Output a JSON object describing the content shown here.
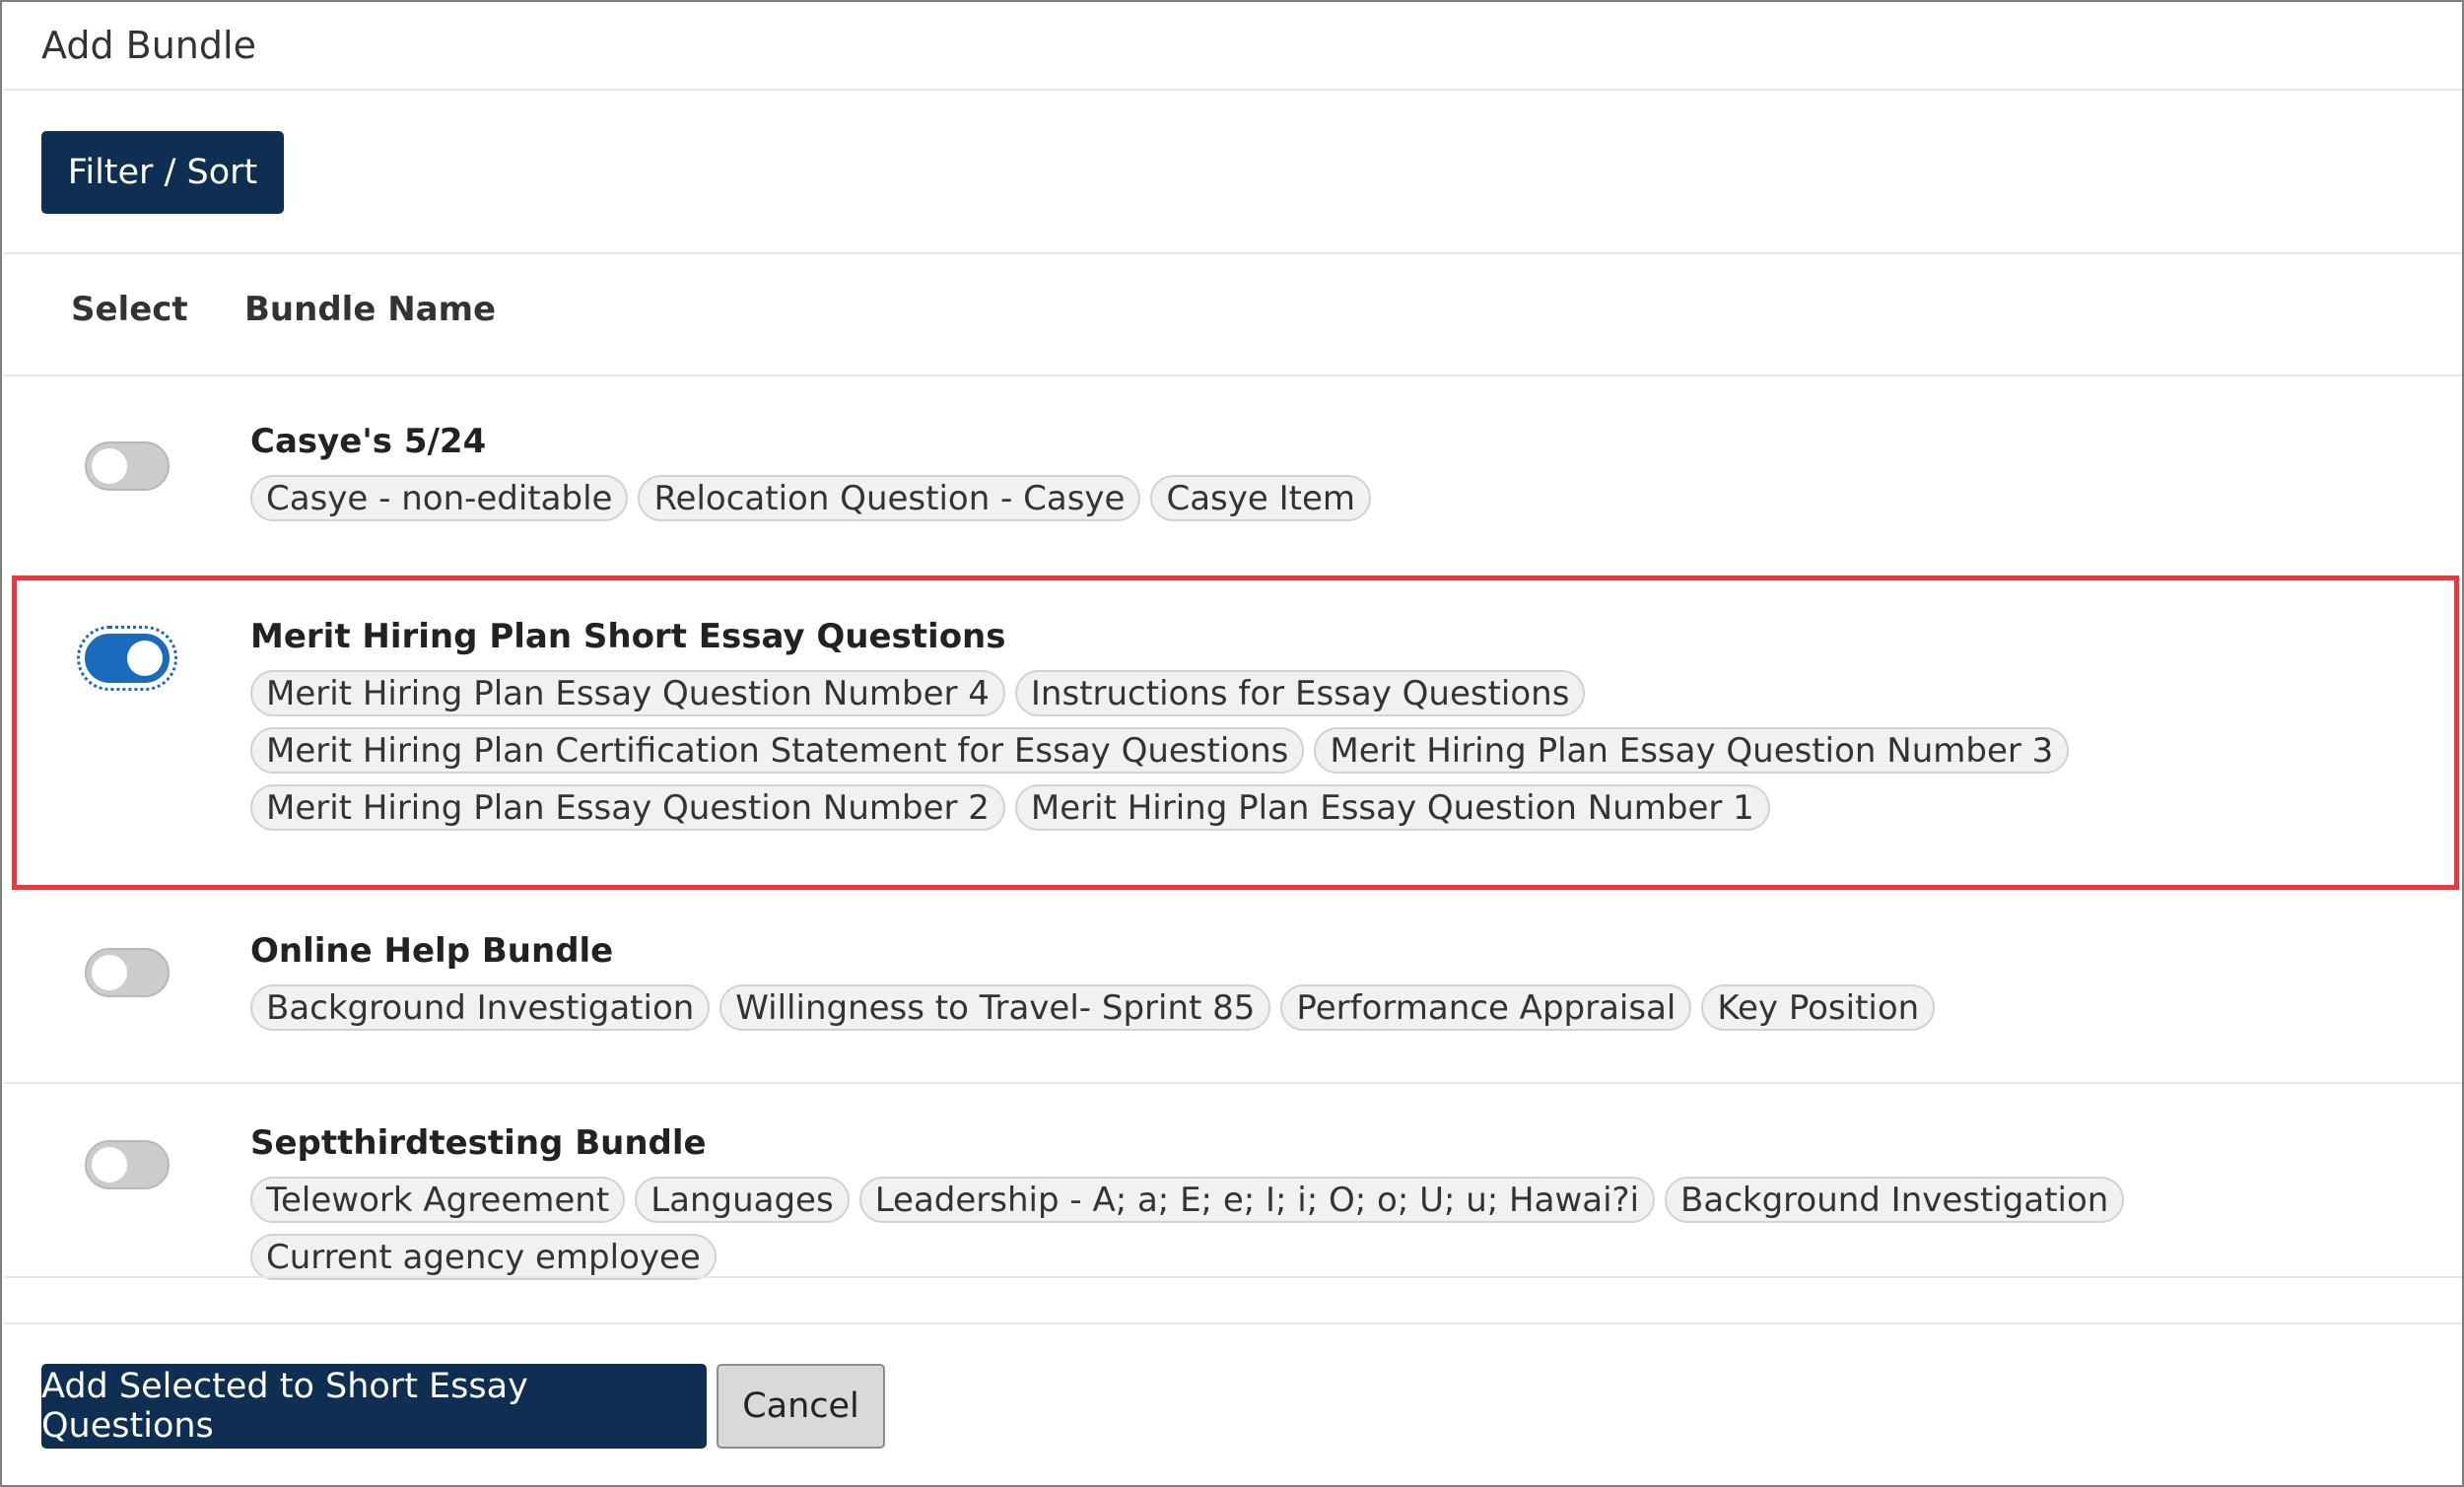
{
  "dialog": {
    "title": "Add Bundle",
    "filter_sort_label": "Filter / Sort"
  },
  "table": {
    "headers": {
      "select": "Select",
      "bundle_name": "Bundle Name"
    },
    "rows": [
      {
        "name": "Casye's 5/24",
        "selected": false,
        "tags": [
          "Casye - non-editable",
          "Relocation Question - Casye",
          "Casye Item"
        ]
      },
      {
        "name": "Merit Hiring Plan Short Essay Questions",
        "selected": true,
        "tags": [
          "Merit Hiring Plan Essay Question Number 4",
          "Instructions for Essay Questions",
          "Merit Hiring Plan Certification Statement for Essay Questions",
          "Merit Hiring Plan Essay Question Number 3",
          "Merit Hiring Plan Essay Question Number 2",
          "Merit Hiring Plan Essay Question Number 1"
        ]
      },
      {
        "name": "Online Help Bundle",
        "selected": false,
        "tags": [
          "Background Investigation",
          "Willingness to Travel- Sprint 85",
          "Performance Appraisal",
          "Key Position"
        ]
      },
      {
        "name": "Septthirdtesting Bundle",
        "selected": false,
        "tags": [
          "Telework Agreement",
          "Languages",
          "Leadership - A; a; E; e; I; i; O; o; U; u; Hawai?i",
          "Background Investigation",
          "Current agency employee"
        ]
      }
    ]
  },
  "footer": {
    "add_label": "Add Selected to Short Essay Questions",
    "cancel_label": "Cancel"
  },
  "colors": {
    "primary": "#0e2e52",
    "toggle_on": "#1b6bbd",
    "highlight": "#e53a3f"
  }
}
